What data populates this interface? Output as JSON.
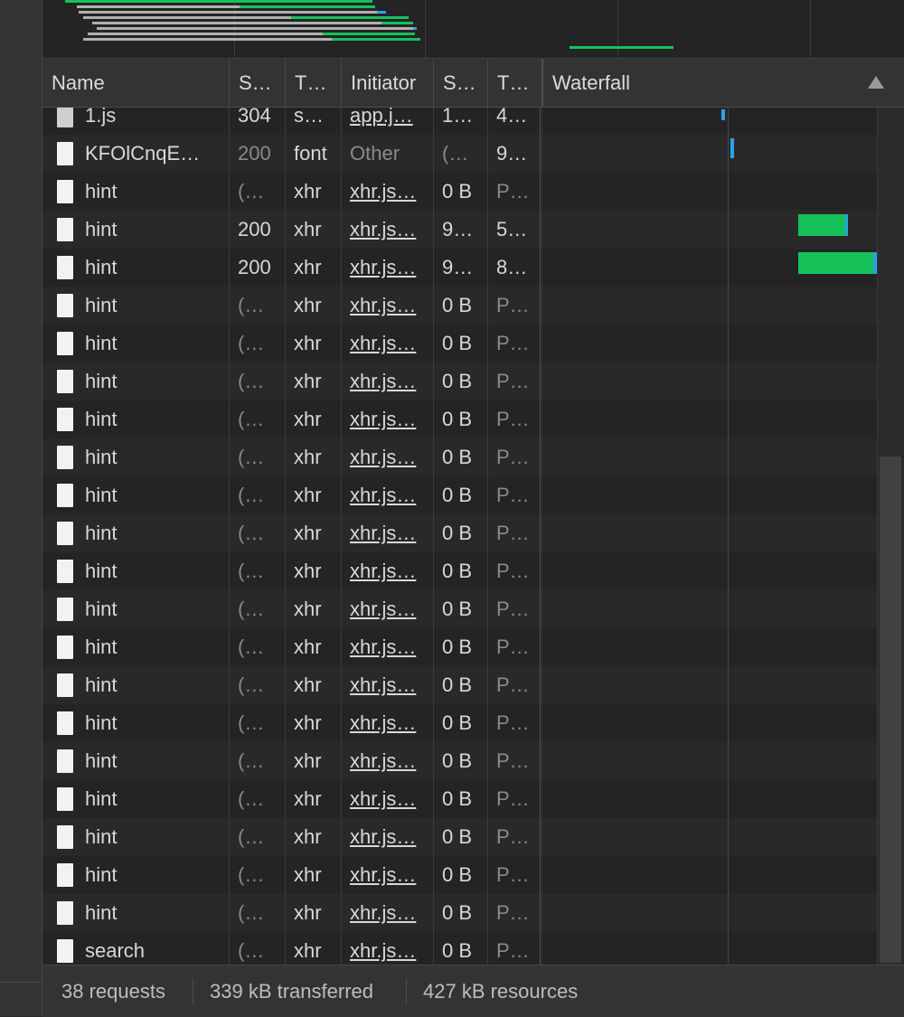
{
  "columns": {
    "name": "Name",
    "status": "S…",
    "type": "T…",
    "initiator": "Initiator",
    "size": "S…",
    "time": "T…",
    "waterfall": "Waterfall"
  },
  "rows": [
    {
      "name": "1.js",
      "status": "304",
      "type": "s…",
      "initiator": "app.j…",
      "size": "1…",
      "time": "4…",
      "icon": "script-file-icon",
      "status_dim": false,
      "time_dim": false
    },
    {
      "name": "KFOlCnqE…",
      "status": "200",
      "type": "font",
      "initiator": "Other",
      "size": "(…",
      "time": "9…",
      "icon": "document-icon",
      "status_dim": true,
      "time_dim": false
    },
    {
      "name": "hint",
      "status": "(…",
      "type": "xhr",
      "initiator": "xhr.js…",
      "size": "0 B",
      "time": "P…",
      "icon": "document-icon",
      "status_dim": true,
      "time_dim": true
    },
    {
      "name": "hint",
      "status": "200",
      "type": "xhr",
      "initiator": "xhr.js…",
      "size": "9…",
      "time": "5…",
      "icon": "document-icon",
      "status_dim": false,
      "time_dim": false
    },
    {
      "name": "hint",
      "status": "200",
      "type": "xhr",
      "initiator": "xhr.js…",
      "size": "9…",
      "time": "8…",
      "icon": "document-icon",
      "status_dim": false,
      "time_dim": false
    },
    {
      "name": "hint",
      "status": "(…",
      "type": "xhr",
      "initiator": "xhr.js…",
      "size": "0 B",
      "time": "P…",
      "icon": "document-icon",
      "status_dim": true,
      "time_dim": true
    },
    {
      "name": "hint",
      "status": "(…",
      "type": "xhr",
      "initiator": "xhr.js…",
      "size": "0 B",
      "time": "P…",
      "icon": "document-icon",
      "status_dim": true,
      "time_dim": true
    },
    {
      "name": "hint",
      "status": "(…",
      "type": "xhr",
      "initiator": "xhr.js…",
      "size": "0 B",
      "time": "P…",
      "icon": "document-icon",
      "status_dim": true,
      "time_dim": true
    },
    {
      "name": "hint",
      "status": "(…",
      "type": "xhr",
      "initiator": "xhr.js…",
      "size": "0 B",
      "time": "P…",
      "icon": "document-icon",
      "status_dim": true,
      "time_dim": true
    },
    {
      "name": "hint",
      "status": "(…",
      "type": "xhr",
      "initiator": "xhr.js…",
      "size": "0 B",
      "time": "P…",
      "icon": "document-icon",
      "status_dim": true,
      "time_dim": true
    },
    {
      "name": "hint",
      "status": "(…",
      "type": "xhr",
      "initiator": "xhr.js…",
      "size": "0 B",
      "time": "P…",
      "icon": "document-icon",
      "status_dim": true,
      "time_dim": true
    },
    {
      "name": "hint",
      "status": "(…",
      "type": "xhr",
      "initiator": "xhr.js…",
      "size": "0 B",
      "time": "P…",
      "icon": "document-icon",
      "status_dim": true,
      "time_dim": true
    },
    {
      "name": "hint",
      "status": "(…",
      "type": "xhr",
      "initiator": "xhr.js…",
      "size": "0 B",
      "time": "P…",
      "icon": "document-icon",
      "status_dim": true,
      "time_dim": true
    },
    {
      "name": "hint",
      "status": "(…",
      "type": "xhr",
      "initiator": "xhr.js…",
      "size": "0 B",
      "time": "P…",
      "icon": "document-icon",
      "status_dim": true,
      "time_dim": true
    },
    {
      "name": "hint",
      "status": "(…",
      "type": "xhr",
      "initiator": "xhr.js…",
      "size": "0 B",
      "time": "P…",
      "icon": "document-icon",
      "status_dim": true,
      "time_dim": true
    },
    {
      "name": "hint",
      "status": "(…",
      "type": "xhr",
      "initiator": "xhr.js…",
      "size": "0 B",
      "time": "P…",
      "icon": "document-icon",
      "status_dim": true,
      "time_dim": true
    },
    {
      "name": "hint",
      "status": "(…",
      "type": "xhr",
      "initiator": "xhr.js…",
      "size": "0 B",
      "time": "P…",
      "icon": "document-icon",
      "status_dim": true,
      "time_dim": true
    },
    {
      "name": "hint",
      "status": "(…",
      "type": "xhr",
      "initiator": "xhr.js…",
      "size": "0 B",
      "time": "P…",
      "icon": "document-icon",
      "status_dim": true,
      "time_dim": true
    },
    {
      "name": "hint",
      "status": "(…",
      "type": "xhr",
      "initiator": "xhr.js…",
      "size": "0 B",
      "time": "P…",
      "icon": "document-icon",
      "status_dim": true,
      "time_dim": true
    },
    {
      "name": "hint",
      "status": "(…",
      "type": "xhr",
      "initiator": "xhr.js…",
      "size": "0 B",
      "time": "P…",
      "icon": "document-icon",
      "status_dim": true,
      "time_dim": true
    },
    {
      "name": "hint",
      "status": "(…",
      "type": "xhr",
      "initiator": "xhr.js…",
      "size": "0 B",
      "time": "P…",
      "icon": "document-icon",
      "status_dim": true,
      "time_dim": true
    },
    {
      "name": "hint",
      "status": "(…",
      "type": "xhr",
      "initiator": "xhr.js…",
      "size": "0 B",
      "time": "P…",
      "icon": "document-icon",
      "status_dim": true,
      "time_dim": true
    },
    {
      "name": "search",
      "status": "(…",
      "type": "xhr",
      "initiator": "xhr.js…",
      "size": "0 B",
      "time": "P…",
      "icon": "document-icon",
      "status_dim": true,
      "time_dim": true
    }
  ],
  "status_bar": {
    "requests": "38 requests",
    "transferred": "339 kB transferred",
    "resources": "427 kB resources"
  },
  "colors": {
    "waiting": "#29a3e6",
    "download": "#16c15a",
    "queued": "#b0b0b0"
  }
}
